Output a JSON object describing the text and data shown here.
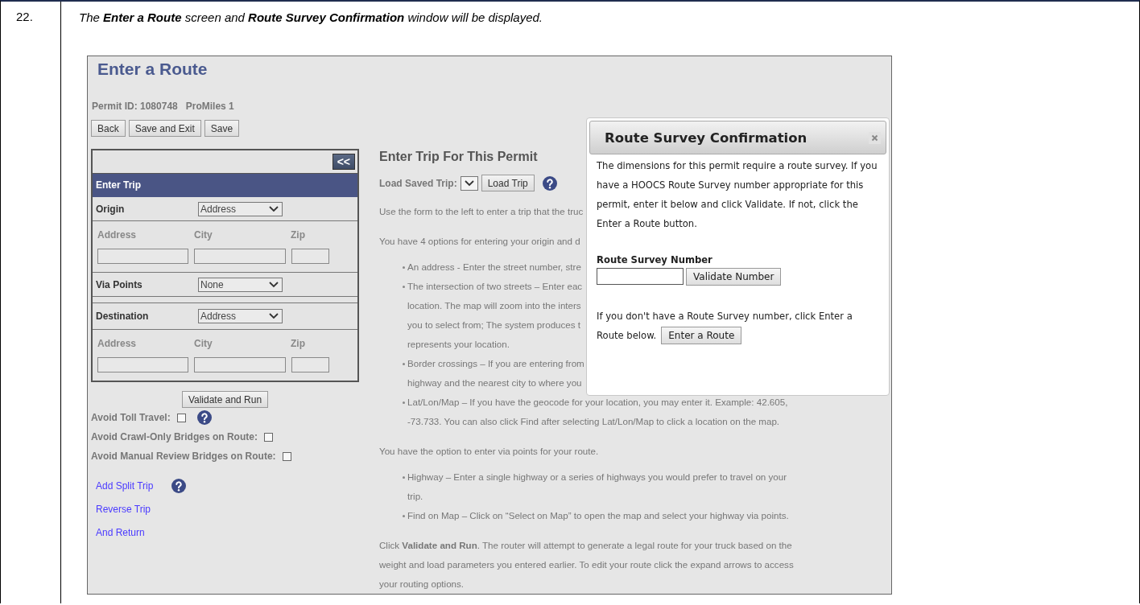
{
  "step": {
    "number": "22.",
    "instruction": "The **Enter a Route** screen and **Route Survey Confirmation** window will be displayed."
  },
  "screen": {
    "title": "Enter a Route",
    "permit_id": "Permit ID: 1080748",
    "provider": "ProMiles 1",
    "buttons": [
      "Back",
      "Save and Exit",
      "Save"
    ],
    "trip_panel": {
      "collapse_button": "<<",
      "header": "Enter Trip",
      "rows": [
        {
          "kind": "select",
          "label": "Origin",
          "value": "Address"
        },
        {
          "kind": "address",
          "columns": [
            "Address",
            "City",
            "Zip"
          ]
        },
        {
          "kind": "select",
          "label": "Via Points",
          "value": "None"
        },
        {
          "kind": "select",
          "label": "Destination",
          "value": "Address"
        },
        {
          "kind": "address",
          "columns": [
            "Address",
            "City",
            "Zip"
          ]
        }
      ]
    },
    "run_button": "Validate and Run",
    "options": [
      {
        "label": "Avoid Toll Travel:",
        "checked": false,
        "help": true
      },
      {
        "label": "Avoid Crawl-Only Bridges on Route:",
        "checked": false,
        "help": false
      },
      {
        "label": "Avoid Manual Review Bridges on Route:",
        "checked": false,
        "help": false
      }
    ],
    "links": [
      {
        "label": "Add Split Trip",
        "help": true
      },
      {
        "label": "Reverse Trip",
        "help": false
      },
      {
        "label": "And Return",
        "help": false
      }
    ],
    "help_heading": "Enter Trip For This Permit",
    "load_saved_trip": {
      "label": "Load Saved Trip:",
      "button": "Load Trip",
      "help": true
    },
    "help_blocks": [
      {
        "kind": "paragraph",
        "lines": [
          "Use the form to the left to enter a trip that the truc"
        ]
      },
      {
        "kind": "paragraph",
        "lines": [
          "You have 4 options for entering your origin and d"
        ]
      },
      {
        "kind": "bullets",
        "items": [
          {
            "lines": [
              "An address - Enter the street number, stre"
            ]
          },
          {
            "lines": [
              "The intersection of two streets – Enter eac",
              "location. The map will zoom into the inters",
              "you to select from; The system produces t",
              "represents your location."
            ]
          },
          {
            "lines": [
              "Border crossings – If you are entering from",
              "highway and the nearest city to where you"
            ]
          },
          {
            "lines": [
              "Lat/Lon/Map – If you have the geocode for your location, you may enter it. Example: 42.605,",
              "-73.733. You can also click Find after selecting Lat/Lon/Map to click a location on the map."
            ]
          }
        ]
      },
      {
        "kind": "paragraph",
        "lines": [
          "You have the option to enter via points for your route."
        ]
      },
      {
        "kind": "bullets",
        "items": [
          {
            "lines": [
              "Highway – Enter a single highway or a series of highways you would prefer to travel on your",
              "trip."
            ]
          },
          {
            "lines": [
              "Find on Map – Click on “Select on Map” to open the map and select your highway via points."
            ]
          }
        ]
      },
      {
        "kind": "paragraph",
        "lines": [
          "Click **Validate and Run**. The router will attempt to generate a legal route for your truck based on the",
          "weight and load parameters you entered earlier. To edit your route click the expand arrows to access",
          "your routing options."
        ]
      }
    ]
  },
  "dialog": {
    "title": "Route Survey Confirmation",
    "message": "The dimensions for this permit require a route survey. If you have a HOOCS Route Survey number appropriate for this permit, enter it below and click Validate. If not, click the Enter a Route button.",
    "field_label": "Route Survey Number",
    "validate_button": "Validate Number",
    "footer_lines": [
      "If you don't have a Route Survey number, click Enter a",
      "Route below."
    ],
    "enter_button": "Enter a Route"
  }
}
